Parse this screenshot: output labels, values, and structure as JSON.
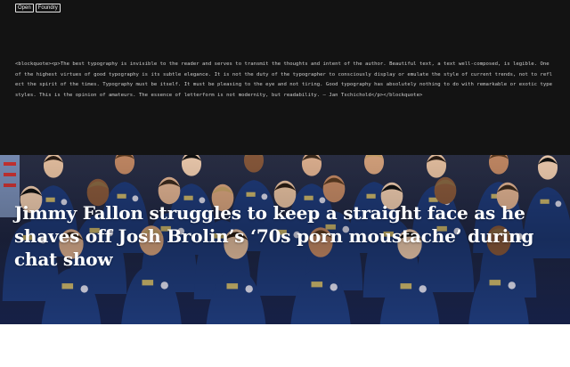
{
  "nav": {
    "open_label": "Open",
    "foundry_label": "Foundry"
  },
  "code_block": {
    "text": "<blockquote><p>The best typography is invisible to the reader and serves to transmit the thoughts and intent of the author. Beautiful text, a text well-composed, is legible. One of the highest virtues of good typography is its subtle elegance. It is not the duty of the typographer to consciously display or emulate the style of current trends, not to reflect the spirit of the times. Typography must be itself. It must be pleasing to the eye and not tiring. Good typography has absolutely nothing to do with remarkable or exotic type styles. This is the opinion of amateurs. The essence of letterform is not modernity, but readability. — Jan Tschichold</p></blockquote>"
  },
  "hero": {
    "headline": "Jimmy Fallon struggles to keep a straight face as he shaves off Josh Brolin’s ‘70s porn moustache’ during chat show",
    "image": "group-photo-astronauts-in-blue-flight-suits"
  },
  "colors": {
    "top_background": "#131313",
    "code_text": "#cfcfcf",
    "flight_suit_blue": "#1f3b7a",
    "headline_text": "#ffffff"
  }
}
